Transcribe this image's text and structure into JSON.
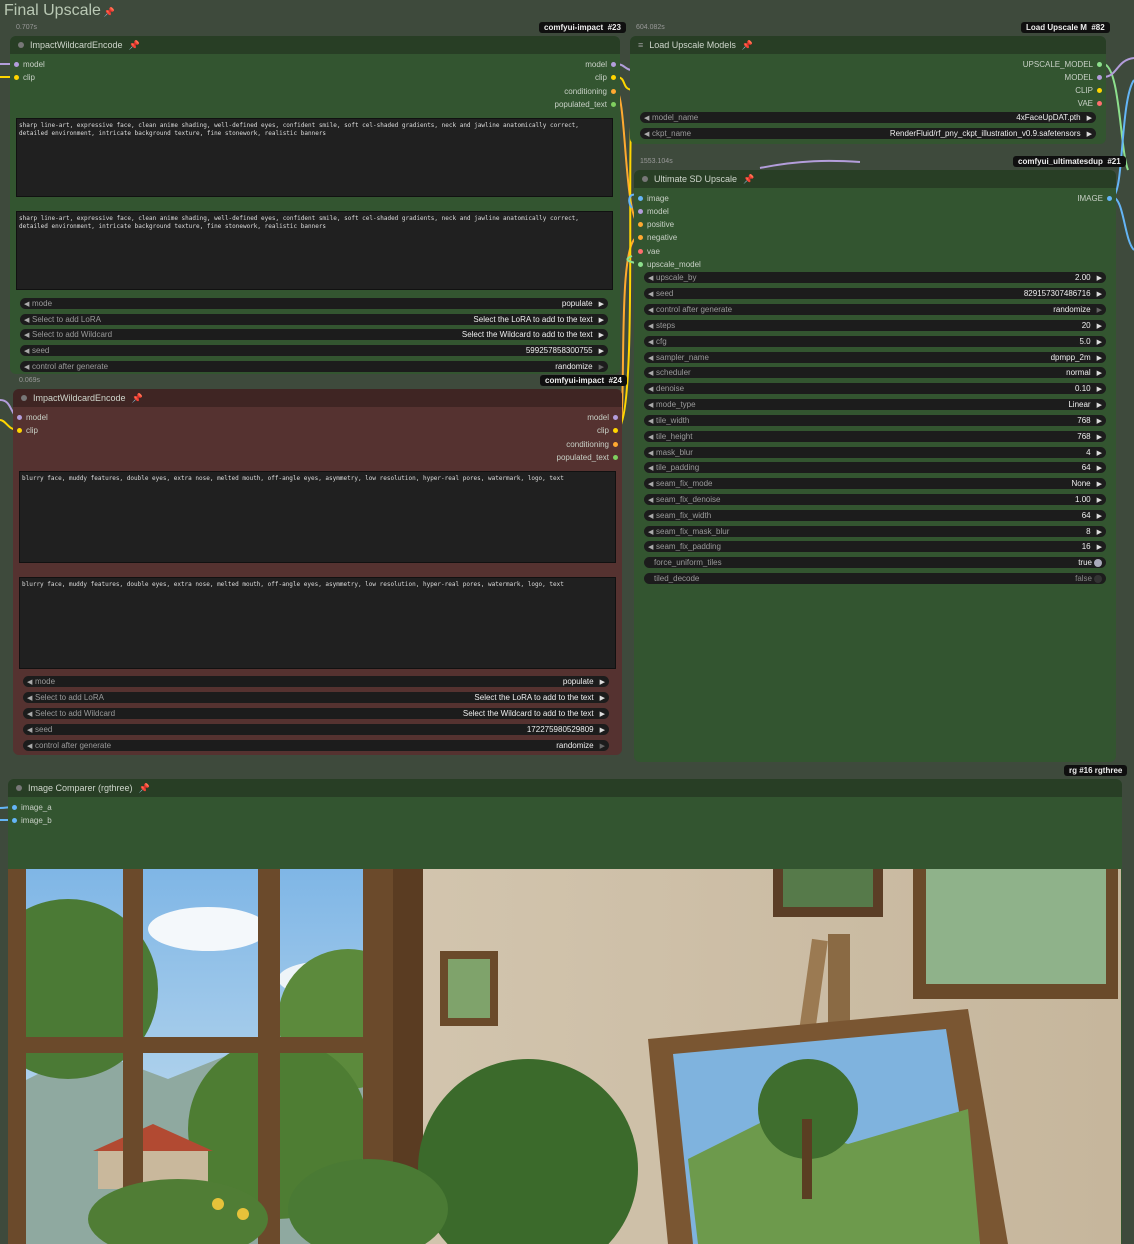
{
  "group": {
    "title": "Final Upscale"
  },
  "node23": {
    "badge_name": "comfyui-impact",
    "badge_id": "#23",
    "timing": "0.707s",
    "title": "ImpactWildcardEncode",
    "inputs": [
      "model",
      "clip"
    ],
    "outputs": [
      "model",
      "clip",
      "conditioning",
      "populated_text"
    ],
    "text1": "sharp line-art, expressive face, clean anime shading, well-defined eyes, confident smile, soft cel-shaded gradients, neck and jawline anatomically correct, detailed environment, intricate background texture, fine stonework, realistic banners",
    "text2": "sharp line-art, expressive face, clean anime shading, well-defined eyes, confident smile, soft cel-shaded gradients, neck and jawline anatomically correct, detailed environment, intricate background texture, fine stonework, realistic banners",
    "widgets": [
      {
        "label": "mode",
        "value": "populate"
      },
      {
        "label": "Select to add LoRA",
        "value": "Select the LoRA to add to the text"
      },
      {
        "label": "Select to add Wildcard",
        "value": "Select the Wildcard to add to the text"
      },
      {
        "label": "seed",
        "value": "599257858300755"
      },
      {
        "label": "control after generate",
        "value": "randomize"
      }
    ]
  },
  "node24": {
    "badge_name": "comfyui-impact",
    "badge_id": "#24",
    "timing": "0.069s",
    "title": "ImpactWildcardEncode",
    "inputs": [
      "model",
      "clip"
    ],
    "outputs": [
      "model",
      "clip",
      "conditioning",
      "populated_text"
    ],
    "text1": "blurry face, muddy features, double eyes, extra nose, melted mouth, off-angle eyes, asymmetry, low resolution, hyper-real pores, watermark, logo, text",
    "text2": "blurry face, muddy features, double eyes, extra nose, melted mouth, off-angle eyes, asymmetry, low resolution, hyper-real pores, watermark, logo, text",
    "widgets": [
      {
        "label": "mode",
        "value": "populate"
      },
      {
        "label": "Select to add LoRA",
        "value": "Select the LoRA to add to the text"
      },
      {
        "label": "Select to add Wildcard",
        "value": "Select the Wildcard to add to the text"
      },
      {
        "label": "seed",
        "value": "172275980529809"
      },
      {
        "label": "control after generate",
        "value": "randomize"
      }
    ]
  },
  "node82": {
    "badge_name": "Load Upscale M",
    "badge_id": "#82",
    "timing": "604.082s",
    "title": "Load Upscale Models",
    "outputs": [
      "UPSCALE_MODEL",
      "MODEL",
      "CLIP",
      "VAE"
    ],
    "widgets": [
      {
        "label": "model_name",
        "value": "4xFaceUpDAT.pth"
      },
      {
        "label": "ckpt_name",
        "value": "RenderFluid/rf_pny_ckpt_illustration_v0.9.safetensors"
      }
    ]
  },
  "node21": {
    "badge_name": "comfyui_ultimatesdup",
    "badge_id": "#21",
    "timing": "1553.104s",
    "title": "Ultimate SD Upscale",
    "inputs": [
      "image",
      "model",
      "positive",
      "negative",
      "vae",
      "upscale_model"
    ],
    "outputs": [
      "IMAGE"
    ],
    "widgets": [
      {
        "label": "upscale_by",
        "value": "2.00"
      },
      {
        "label": "seed",
        "value": "829157307486716"
      },
      {
        "label": "control after generate",
        "value": "randomize"
      },
      {
        "label": "steps",
        "value": "20"
      },
      {
        "label": "cfg",
        "value": "5.0"
      },
      {
        "label": "sampler_name",
        "value": "dpmpp_2m"
      },
      {
        "label": "scheduler",
        "value": "normal"
      },
      {
        "label": "denoise",
        "value": "0.10"
      },
      {
        "label": "mode_type",
        "value": "Linear"
      },
      {
        "label": "tile_width",
        "value": "768"
      },
      {
        "label": "tile_height",
        "value": "768"
      },
      {
        "label": "mask_blur",
        "value": "4"
      },
      {
        "label": "tile_padding",
        "value": "64"
      },
      {
        "label": "seam_fix_mode",
        "value": "None"
      },
      {
        "label": "seam_fix_denoise",
        "value": "1.00"
      },
      {
        "label": "seam_fix_width",
        "value": "64"
      },
      {
        "label": "seam_fix_mask_blur",
        "value": "8"
      },
      {
        "label": "seam_fix_padding",
        "value": "16"
      }
    ],
    "toggles": [
      {
        "label": "force_uniform_tiles",
        "value": "true"
      },
      {
        "label": "tiled_decode",
        "value": "false"
      }
    ]
  },
  "node16": {
    "badge_name": "rg #16 rgthree",
    "title": "Image Comparer (rgthree)",
    "inputs": [
      "image_a",
      "image_b"
    ]
  },
  "colors": {
    "model": "#b39ddb",
    "clip": "#ffd500",
    "conditioning": "#ffa931",
    "string": "#7fcf5f",
    "image": "#64b5f6",
    "vae": "#ff6e6e",
    "upscale_model": "#8de08d"
  }
}
